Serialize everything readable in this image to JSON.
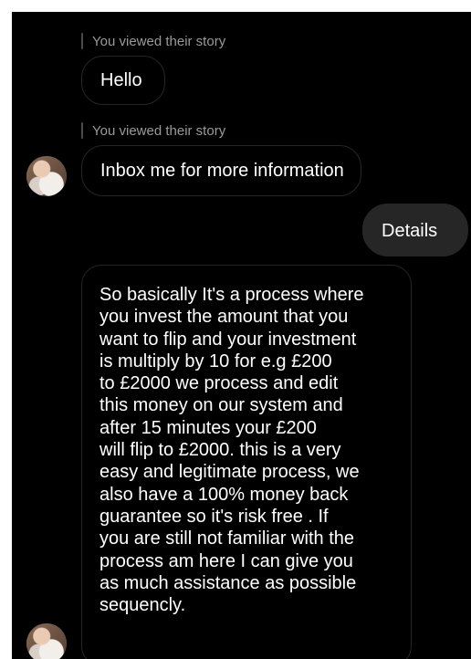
{
  "thread": {
    "story_reply_1": "You viewed their story",
    "message_1": "Hello",
    "story_reply_2": "You viewed their story",
    "message_2": "Inbox me for more information",
    "sent_message": "Details",
    "long_message_lines": [
      "So  basically It's a process where",
      "you invest the amount that you",
      "want to flip and your investment",
      "is multiply by 10 for e.g £200",
      "to £2000 we process and edit",
      "this money on our system and",
      "after 15 minutes your £200",
      "will flip to £2000. this is a very",
      "easy and legitimate process, we",
      "also have a 100% money back",
      "guarantee so it's risk free . If",
      "you are still not familiar with the",
      "process am here I can give you",
      "as much assistance as possible",
      "sequencly."
    ]
  }
}
